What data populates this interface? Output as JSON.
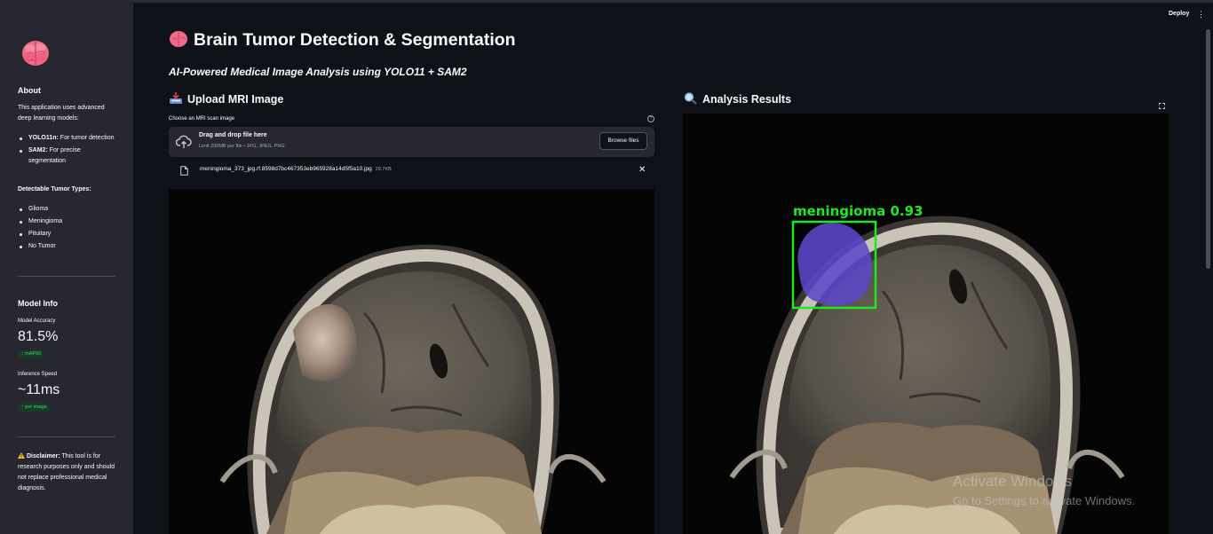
{
  "sidebar": {
    "about_heading": "About",
    "about_text": "This application uses advanced deep learning models:",
    "models": [
      {
        "name": "YOLO11n:",
        "desc": " For tumor detection"
      },
      {
        "name": "SAM2:",
        "desc": " For precise segmentation"
      }
    ],
    "tumor_types_heading": "Detectable Tumor Types:",
    "tumor_types": [
      "Glioma",
      "Meningioma",
      "Pituitary",
      "No Tumor"
    ],
    "model_info_heading": "Model Info",
    "metrics": [
      {
        "label": "Model Accuracy",
        "value": "81.5%",
        "delta": "↑ mAP50"
      },
      {
        "label": "Inference Speed",
        "value": "~11ms",
        "delta": "↑ per image"
      }
    ],
    "disclaimer_label": "Disclaimer:",
    "disclaimer_text": " This tool is for research purposes only and should not replace professional medical diagnosis."
  },
  "header": {
    "deploy_label": "Deploy",
    "menu_glyph": "⋮"
  },
  "main": {
    "title": "Brain Tumor Detection & Segmentation",
    "subtitle": "AI-Powered Medical Image Analysis using YOLO11 + SAM2",
    "upload_heading": "Upload MRI Image",
    "results_heading": "Analysis Results",
    "uploader": {
      "label": "Choose an MRI scan image",
      "help_glyph": "?",
      "drag_text": "Drag and drop file here",
      "limit_text": "Limit 200MB per file • JPG, JPEG, PNG",
      "browse_label": "Browse files"
    },
    "file": {
      "name": "meningioma_373_jpg.rf.8598d7bc467353eb965928a14d5f5a10.jpg",
      "size": "29.7KB",
      "close_glyph": "✕"
    },
    "detection": {
      "label": "meningioma 0.93",
      "box_color": "#1ee81e",
      "mask_color": "#5a48c8"
    }
  },
  "watermark": {
    "line1": "Activate Windows",
    "line2": "Go to Settings to activate Windows."
  },
  "colors": {
    "app_bg": "#0e1117",
    "sidebar_bg": "#262730",
    "delta_green": "#3dd56d"
  },
  "icons": [
    "brain-icon",
    "inbox-tray-icon",
    "magnifier-icon",
    "cloud-upload-icon",
    "file-icon",
    "close-icon",
    "help-icon",
    "warning-icon",
    "fullscreen-icon",
    "kebab-menu-icon"
  ]
}
